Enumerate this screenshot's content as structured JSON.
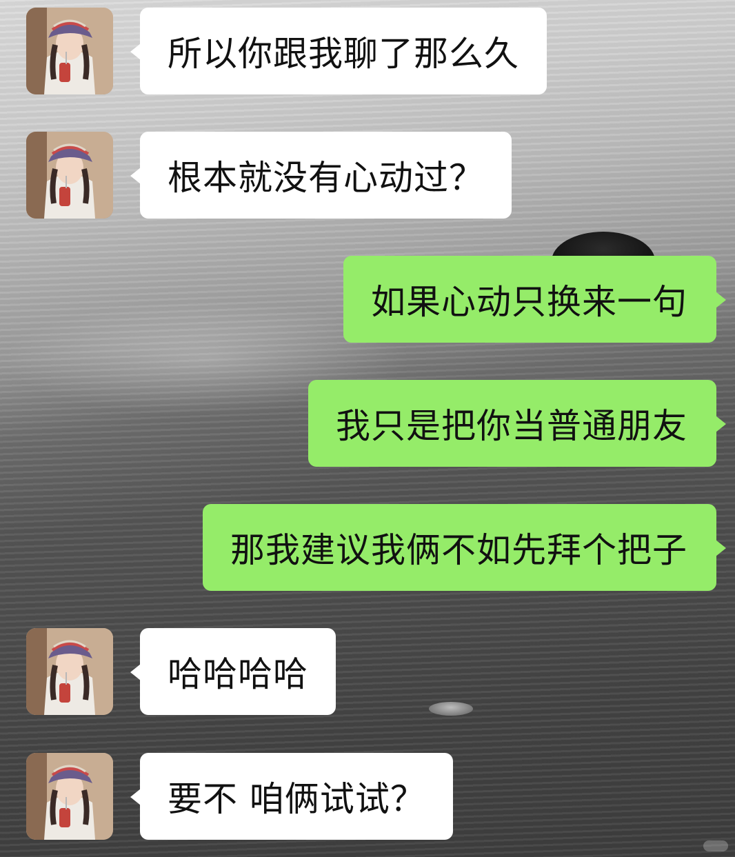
{
  "chat": {
    "messages": [
      {
        "sender": "contact",
        "text": "所以你跟我聊了那么久"
      },
      {
        "sender": "contact",
        "text": "根本就没有心动过？"
      },
      {
        "sender": "me",
        "text": "如果心动只换来一句"
      },
      {
        "sender": "me",
        "text": "我只是把你当普通朋友"
      },
      {
        "sender": "me",
        "text": "那我建议我俩不如先拜个把子"
      },
      {
        "sender": "contact",
        "text": "哈哈哈哈"
      },
      {
        "sender": "contact",
        "text": "要不 咱俩试试？"
      }
    ]
  },
  "colors": {
    "incoming_bubble": "#ffffff",
    "outgoing_bubble": "#95ec69",
    "text": "#111111"
  },
  "icons": {
    "avatar": "avatar-icon"
  }
}
